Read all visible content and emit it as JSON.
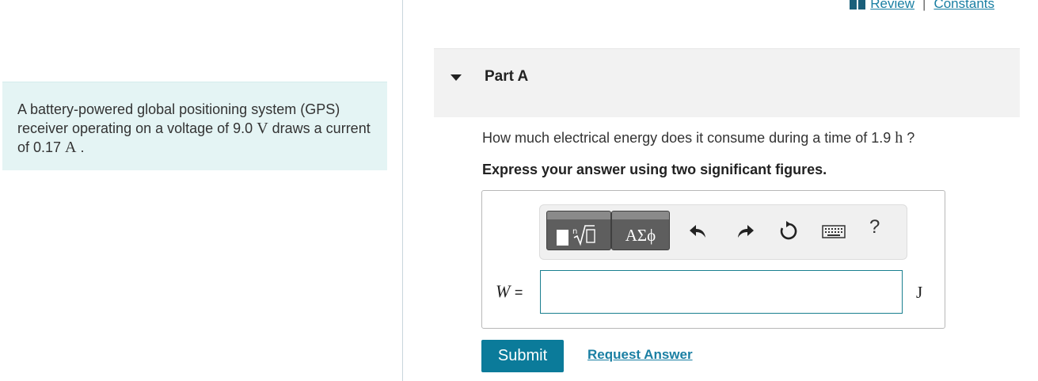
{
  "header": {
    "review_label": "Review",
    "separator": "|",
    "constants_label": "Constants"
  },
  "problem": {
    "text_part1": "A battery-powered global positioning system (GPS) receiver operating on a voltage of 9.0 ",
    "unit_v": "V",
    "text_part2": " draws a current of 0.17 ",
    "unit_a": "A",
    "text_part3": " ."
  },
  "part": {
    "title": "Part A",
    "question_part1": "How much electrical energy does it consume during a time of 1.9 ",
    "question_unit": "h",
    "question_part2": " ?",
    "instruction": "Express your answer using two significant figures."
  },
  "toolbar": {
    "symbols_label": "ΑΣϕ",
    "help_label": "?"
  },
  "answer": {
    "variable": "W",
    "equals": "=",
    "value": "",
    "unit": "J"
  },
  "actions": {
    "submit_label": "Submit",
    "request_answer_label": "Request Answer"
  },
  "colors": {
    "accent": "#0b7b9a",
    "link": "#1a7fa3",
    "problem_bg": "#e4f4f4"
  }
}
